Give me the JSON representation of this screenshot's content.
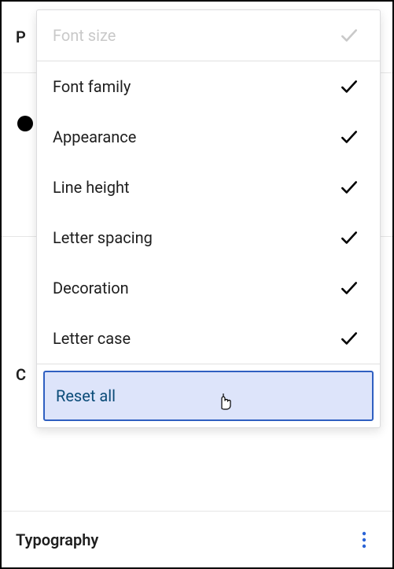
{
  "bg": {
    "p_label": "P",
    "c_label": "C"
  },
  "menu": {
    "items": [
      {
        "label": "Font size",
        "disabled": true
      },
      {
        "label": "Font family",
        "disabled": false
      },
      {
        "label": "Appearance",
        "disabled": false
      },
      {
        "label": "Line height",
        "disabled": false
      },
      {
        "label": "Letter spacing",
        "disabled": false
      },
      {
        "label": "Decoration",
        "disabled": false
      },
      {
        "label": "Letter case",
        "disabled": false
      }
    ],
    "reset_label": "Reset all"
  },
  "footer": {
    "title": "Typography"
  }
}
